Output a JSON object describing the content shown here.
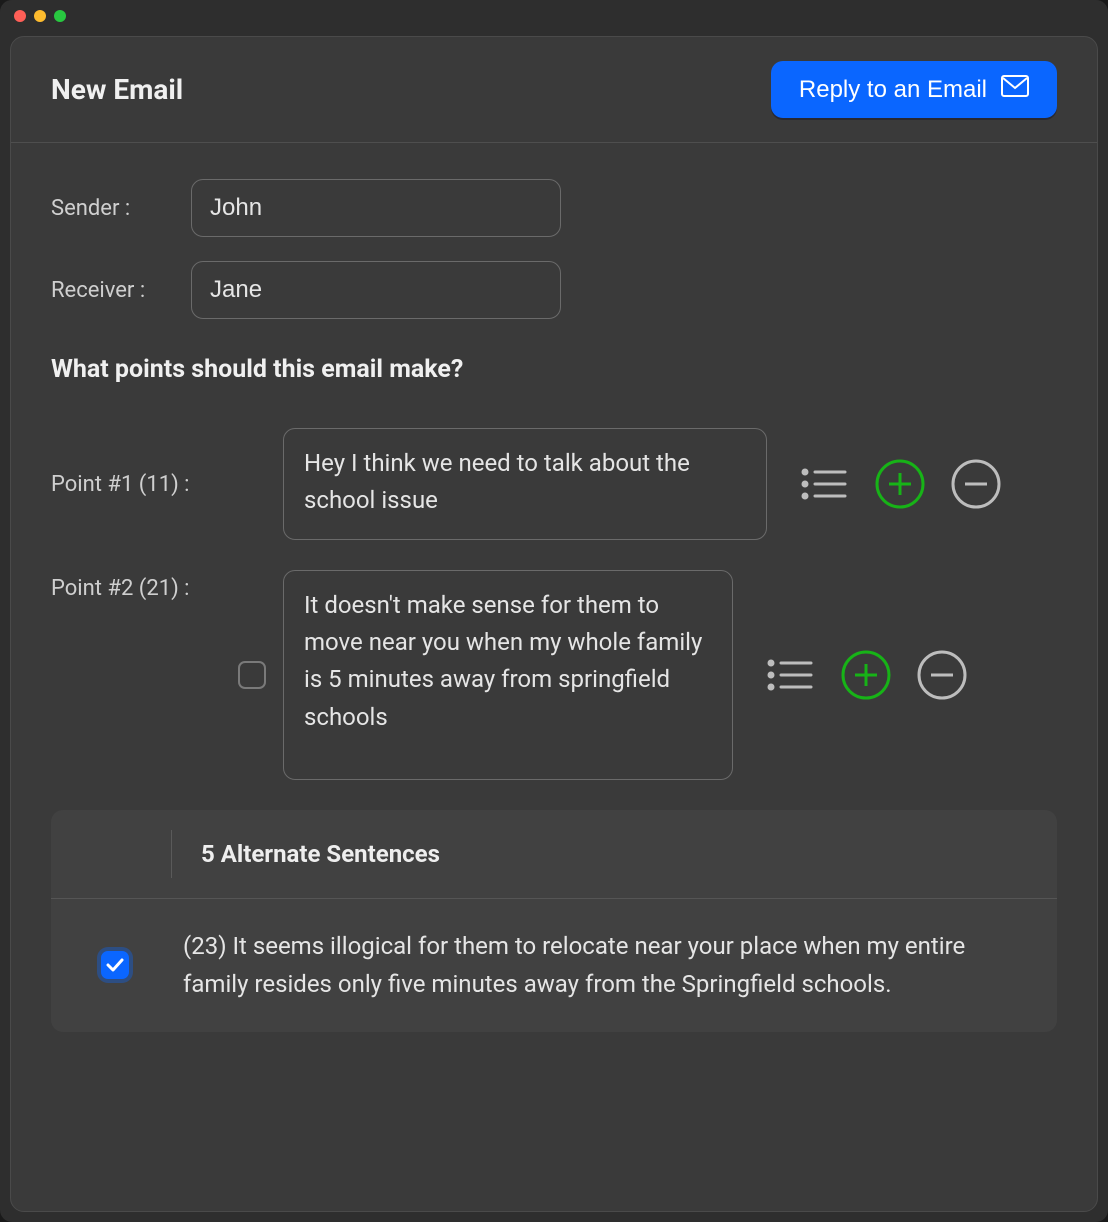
{
  "header": {
    "title": "New Email",
    "reply_button": "Reply to an Email"
  },
  "form": {
    "sender_label": "Sender :",
    "sender_value": "John",
    "receiver_label": "Receiver :",
    "receiver_value": "Jane"
  },
  "question": "What points should this email make?",
  "points": [
    {
      "label": "Point #1 (11) :",
      "text": "Hey I think we need to talk about the school issue",
      "has_checkbox": false,
      "checked": false
    },
    {
      "label": "Point #2 (21) :",
      "text": "It doesn't make sense for them to move near you when my whole family is 5 minutes away from springfield schools",
      "has_checkbox": true,
      "checked": false
    }
  ],
  "alternates": {
    "header": "5 Alternate Sentences",
    "items": [
      {
        "checked": true,
        "text": "(23) It seems illogical for them to relocate near your place when my entire family resides only five minutes away from the Springfield schools."
      }
    ]
  }
}
